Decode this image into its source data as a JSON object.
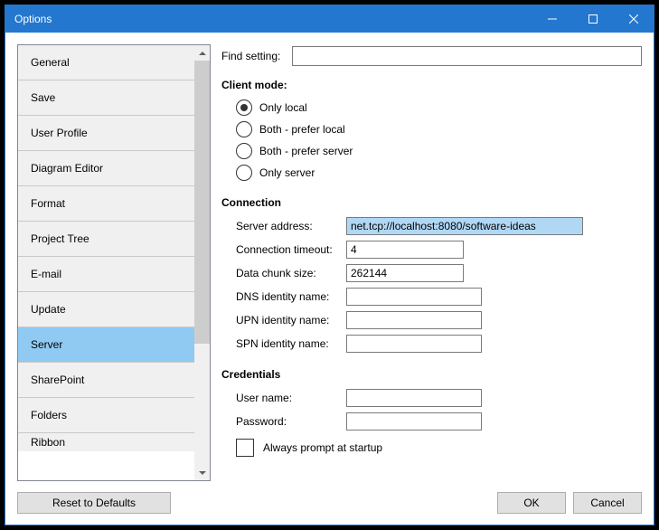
{
  "window": {
    "title": "Options"
  },
  "sidebar": {
    "items": [
      {
        "label": "General"
      },
      {
        "label": "Save"
      },
      {
        "label": "User Profile"
      },
      {
        "label": "Diagram Editor"
      },
      {
        "label": "Format"
      },
      {
        "label": "Project Tree"
      },
      {
        "label": "E-mail"
      },
      {
        "label": "Update"
      },
      {
        "label": "Server",
        "selected": true
      },
      {
        "label": "SharePoint"
      },
      {
        "label": "Folders"
      },
      {
        "label": "Ribbon"
      }
    ]
  },
  "main": {
    "find_label": "Find setting:",
    "find_value": "",
    "client_mode": {
      "title": "Client mode:",
      "options": [
        "Only local",
        "Both - prefer local",
        "Both - prefer server",
        "Only server"
      ],
      "selected": 0
    },
    "connection": {
      "title": "Connection",
      "server_address_label": "Server address:",
      "server_address_value": "net.tcp://localhost:8080/software-ideas",
      "connection_timeout_label": "Connection timeout:",
      "connection_timeout_value": "4",
      "data_chunk_label": "Data chunk size:",
      "data_chunk_value": "262144",
      "dns_label": "DNS identity name:",
      "dns_value": "",
      "upn_label": "UPN identity name:",
      "upn_value": "",
      "spn_label": "SPN identity name:",
      "spn_value": ""
    },
    "credentials": {
      "title": "Credentials",
      "user_label": "User name:",
      "user_value": "",
      "password_label": "Password:",
      "password_value": "",
      "always_prompt_label": "Always prompt at startup",
      "always_prompt_checked": false
    }
  },
  "footer": {
    "reset_label": "Reset to Defaults",
    "ok_label": "OK",
    "cancel_label": "Cancel"
  }
}
